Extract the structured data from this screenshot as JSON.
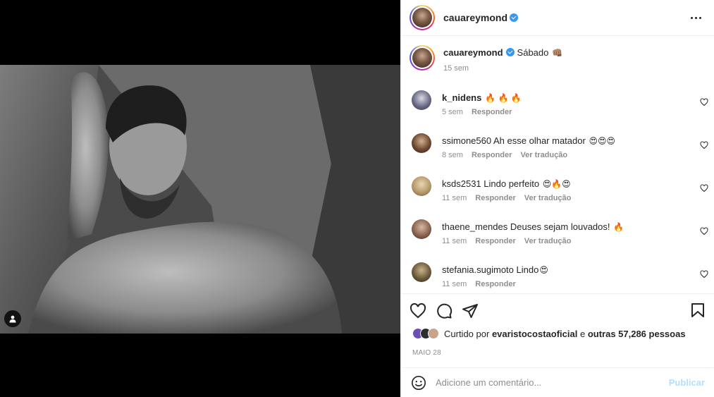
{
  "post": {
    "username": "cauareymond",
    "caption_text": "Sábado",
    "caption_emoji": "👊🏽",
    "caption_time": "15 sem"
  },
  "comments": [
    {
      "user": "k_nidens",
      "text": "",
      "emoji": "🔥 🔥 🔥",
      "time": "5 sem",
      "reply": "Responder",
      "translate": ""
    },
    {
      "user": "ssimone560",
      "text": "Ah esse olhar matador",
      "emoji": "😍😍😍",
      "time": "8 sem",
      "reply": "Responder",
      "translate": "Ver tradução"
    },
    {
      "user": "ksds2531",
      "text": "Lindo perfeito",
      "emoji": "😍🔥😍",
      "time": "11 sem",
      "reply": "Responder",
      "translate": "Ver tradução"
    },
    {
      "user": "thaene_mendes",
      "text": "Deuses sejam louvados!",
      "emoji": "🔥",
      "time": "11 sem",
      "reply": "Responder",
      "translate": "Ver tradução"
    },
    {
      "user": "stefania.sugimoto",
      "text": "Lindo",
      "emoji": "😍",
      "time": "11 sem",
      "reply": "Responder",
      "translate": ""
    }
  ],
  "likes": {
    "prefix": "Curtido por",
    "first_user": "evaristocostaoficial",
    "connector": "e",
    "others": "outras 57,286 pessoas"
  },
  "date": "MAIO 28",
  "add_comment": {
    "placeholder": "Adicione um comentário...",
    "publish": "Publicar"
  },
  "icons": {
    "more": "more-horizontal-icon",
    "like": "heart-icon",
    "comment": "comment-bubble-icon",
    "share": "paper-plane-icon",
    "save": "bookmark-icon",
    "emoji": "smiley-icon",
    "tag": "user-tag-icon",
    "verified": "verified-badge-icon"
  },
  "colors": {
    "verified": "#3897f0",
    "publish_disabled": "#b2dffc",
    "meta_text": "#8e8e8e"
  }
}
